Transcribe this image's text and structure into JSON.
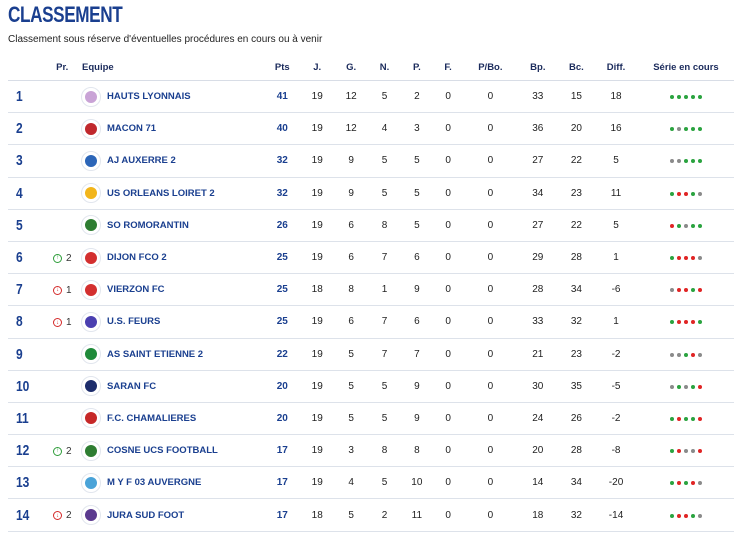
{
  "page": {
    "title": "CLASSEMENT",
    "subtitle": "Classement sous réserve d'éventuelles procédures en cours ou à venir"
  },
  "headers": {
    "rank": "",
    "pr": "Pr.",
    "team": "Equipe",
    "pts": "Pts",
    "j": "J.",
    "g": "G.",
    "n": "N.",
    "p": "P.",
    "f": "F.",
    "pbo": "P/Bo.",
    "bp": "Bp.",
    "bc": "Bc.",
    "diff": "Diff.",
    "series": "Série en cours"
  },
  "colors": {
    "win": "#2aa33f",
    "loss": "#e02424",
    "draw": "#8a8a8a",
    "accent": "#1a3f8f"
  },
  "rows": [
    {
      "rank": "1",
      "pr_dir": "",
      "pr_val": "",
      "team": "HAUTS LYONNAIS",
      "logo": "#c9a3d6",
      "pts": "41",
      "j": "19",
      "g": "12",
      "n": "5",
      "p": "2",
      "f": "0",
      "pbo": "0",
      "bp": "33",
      "bc": "15",
      "diff": "18",
      "series": [
        "V",
        "V",
        "V",
        "V",
        "V"
      ]
    },
    {
      "rank": "2",
      "pr_dir": "",
      "pr_val": "",
      "team": "MACON 71",
      "logo": "#c0282d",
      "pts": "40",
      "j": "19",
      "g": "12",
      "n": "4",
      "p": "3",
      "f": "0",
      "pbo": "0",
      "bp": "36",
      "bc": "20",
      "diff": "16",
      "series": [
        "V",
        "N",
        "V",
        "V",
        "V"
      ]
    },
    {
      "rank": "3",
      "pr_dir": "",
      "pr_val": "",
      "team": "AJ AUXERRE 2",
      "logo": "#2b65b8",
      "pts": "32",
      "j": "19",
      "g": "9",
      "n": "5",
      "p": "5",
      "f": "0",
      "pbo": "0",
      "bp": "27",
      "bc": "22",
      "diff": "5",
      "series": [
        "N",
        "N",
        "V",
        "V",
        "V"
      ]
    },
    {
      "rank": "4",
      "pr_dir": "",
      "pr_val": "",
      "team": "US ORLEANS LOIRET 2",
      "logo": "#f2b51b",
      "pts": "32",
      "j": "19",
      "g": "9",
      "n": "5",
      "p": "5",
      "f": "0",
      "pbo": "0",
      "bp": "34",
      "bc": "23",
      "diff": "11",
      "series": [
        "V",
        "D",
        "D",
        "V",
        "N"
      ]
    },
    {
      "rank": "5",
      "pr_dir": "",
      "pr_val": "",
      "team": "SO ROMORANTIN",
      "logo": "#2e7d32",
      "pts": "26",
      "j": "19",
      "g": "6",
      "n": "8",
      "p": "5",
      "f": "0",
      "pbo": "0",
      "bp": "27",
      "bc": "22",
      "diff": "5",
      "series": [
        "D",
        "V",
        "N",
        "V",
        "V"
      ]
    },
    {
      "rank": "6",
      "pr_dir": "up",
      "pr_val": "2",
      "team": "DIJON FCO 2",
      "logo": "#d32f2f",
      "pts": "25",
      "j": "19",
      "g": "6",
      "n": "7",
      "p": "6",
      "f": "0",
      "pbo": "0",
      "bp": "29",
      "bc": "28",
      "diff": "1",
      "series": [
        "V",
        "D",
        "D",
        "D",
        "N"
      ]
    },
    {
      "rank": "7",
      "pr_dir": "down",
      "pr_val": "1",
      "team": "VIERZON FC",
      "logo": "#d32f2f",
      "pts": "25",
      "j": "18",
      "g": "8",
      "n": "1",
      "p": "9",
      "f": "0",
      "pbo": "0",
      "bp": "28",
      "bc": "34",
      "diff": "-6",
      "series": [
        "N",
        "D",
        "D",
        "V",
        "D"
      ]
    },
    {
      "rank": "8",
      "pr_dir": "down",
      "pr_val": "1",
      "team": "U.S. FEURS",
      "logo": "#4a3fb0",
      "pts": "25",
      "j": "19",
      "g": "6",
      "n": "7",
      "p": "6",
      "f": "0",
      "pbo": "0",
      "bp": "33",
      "bc": "32",
      "diff": "1",
      "series": [
        "V",
        "D",
        "D",
        "D",
        "V"
      ]
    },
    {
      "rank": "9",
      "pr_dir": "",
      "pr_val": "",
      "team": "AS SAINT ETIENNE 2",
      "logo": "#1f8a3a",
      "pts": "22",
      "j": "19",
      "g": "5",
      "n": "7",
      "p": "7",
      "f": "0",
      "pbo": "0",
      "bp": "21",
      "bc": "23",
      "diff": "-2",
      "series": [
        "N",
        "N",
        "V",
        "D",
        "N"
      ]
    },
    {
      "rank": "10",
      "pr_dir": "",
      "pr_val": "",
      "team": "SARAN FC",
      "logo": "#1c2c6b",
      "pts": "20",
      "j": "19",
      "g": "5",
      "n": "5",
      "p": "9",
      "f": "0",
      "pbo": "0",
      "bp": "30",
      "bc": "35",
      "diff": "-5",
      "series": [
        "N",
        "V",
        "N",
        "V",
        "D"
      ]
    },
    {
      "rank": "11",
      "pr_dir": "",
      "pr_val": "",
      "team": "F.C. CHAMALIERES",
      "logo": "#c62828",
      "pts": "20",
      "j": "19",
      "g": "5",
      "n": "5",
      "p": "9",
      "f": "0",
      "pbo": "0",
      "bp": "24",
      "bc": "26",
      "diff": "-2",
      "series": [
        "V",
        "D",
        "V",
        "V",
        "D"
      ]
    },
    {
      "rank": "12",
      "pr_dir": "up",
      "pr_val": "2",
      "team": "COSNE UCS FOOTBALL",
      "logo": "#2e7d32",
      "pts": "17",
      "j": "19",
      "g": "3",
      "n": "8",
      "p": "8",
      "f": "0",
      "pbo": "0",
      "bp": "20",
      "bc": "28",
      "diff": "-8",
      "series": [
        "V",
        "D",
        "N",
        "N",
        "D"
      ]
    },
    {
      "rank": "13",
      "pr_dir": "",
      "pr_val": "",
      "team": "M Y F 03 AUVERGNE",
      "logo": "#4aa3d8",
      "pts": "17",
      "j": "19",
      "g": "4",
      "n": "5",
      "p": "10",
      "f": "0",
      "pbo": "0",
      "bp": "14",
      "bc": "34",
      "diff": "-20",
      "series": [
        "V",
        "D",
        "V",
        "D",
        "N"
      ]
    },
    {
      "rank": "14",
      "pr_dir": "down",
      "pr_val": "2",
      "team": "JURA SUD FOOT",
      "logo": "#5b3a8f",
      "pts": "17",
      "j": "18",
      "g": "5",
      "n": "2",
      "p": "11",
      "f": "0",
      "pbo": "0",
      "bp": "18",
      "bc": "32",
      "diff": "-14",
      "series": [
        "V",
        "D",
        "D",
        "V",
        "N"
      ]
    }
  ]
}
